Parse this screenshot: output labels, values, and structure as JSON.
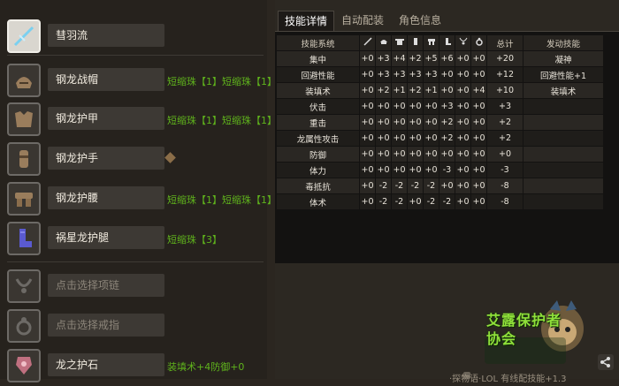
{
  "equipment": {
    "slots": [
      {
        "name": "彗羽流",
        "decorations": "",
        "icon": "sword-icon",
        "empty": false
      },
      {
        "name": "钢龙战帽",
        "decorations": "短缩珠【1】短缩珠【1】",
        "icon": "helmet-icon",
        "empty": false
      },
      {
        "name": "钢龙护甲",
        "decorations": "短缩珠【1】短缩珠【1】",
        "icon": "chest-armor-icon",
        "empty": false
      },
      {
        "name": "钢龙护手",
        "decorations": "",
        "icon": "gauntlet-icon",
        "empty": false
      },
      {
        "name": "钢龙护腰",
        "decorations": "短缩珠【1】短缩珠【1】",
        "icon": "waist-armor-icon",
        "empty": false
      },
      {
        "name": "祸星龙护腿",
        "decorations": "短缩珠【3】",
        "icon": "leg-armor-icon",
        "empty": false
      },
      {
        "name": "点击选择项链",
        "decorations": "",
        "icon": "necklace-icon",
        "empty": true
      },
      {
        "name": "点击选择戒指",
        "decorations": "",
        "icon": "ring-icon",
        "empty": true
      },
      {
        "name": "龙之护石",
        "decorations": "装填术+4防御+0",
        "icon": "talisman-icon",
        "empty": false
      }
    ]
  },
  "tabs": [
    {
      "label": "技能详情",
      "active": true
    },
    {
      "label": "自动配装",
      "active": false
    },
    {
      "label": "角色信息",
      "active": false
    }
  ],
  "skill_table": {
    "headers": {
      "system": "技能系统",
      "part_icons": [
        "weapon-icon",
        "helmet-icon",
        "chest-icon",
        "arm-icon",
        "waist-icon",
        "leg-icon",
        "amulet-icon",
        "ring-icon"
      ],
      "total": "总计",
      "activated": "发动技能"
    },
    "rows": [
      {
        "name": "集中",
        "values": [
          "+0",
          "+3",
          "+4",
          "+2",
          "+5",
          "+6",
          "+0",
          "+0"
        ],
        "total": "+20",
        "active": "凝神"
      },
      {
        "name": "回避性能",
        "values": [
          "+0",
          "+3",
          "+3",
          "+3",
          "+3",
          "+0",
          "+0",
          "+0"
        ],
        "total": "+12",
        "active": "回避性能+1"
      },
      {
        "name": "装填术",
        "values": [
          "+0",
          "+2",
          "+1",
          "+2",
          "+1",
          "+0",
          "+0",
          "+4"
        ],
        "total": "+10",
        "active": "装填术"
      },
      {
        "name": "伏击",
        "values": [
          "+0",
          "+0",
          "+0",
          "+0",
          "+0",
          "+3",
          "+0",
          "+0"
        ],
        "total": "+3",
        "active": ""
      },
      {
        "name": "重击",
        "values": [
          "+0",
          "+0",
          "+0",
          "+0",
          "+0",
          "+2",
          "+0",
          "+0"
        ],
        "total": "+2",
        "active": ""
      },
      {
        "name": "龙属性攻击",
        "values": [
          "+0",
          "+0",
          "+0",
          "+0",
          "+0",
          "+2",
          "+0",
          "+0"
        ],
        "total": "+2",
        "active": ""
      },
      {
        "name": "防御",
        "values": [
          "+0",
          "+0",
          "+0",
          "+0",
          "+0",
          "+0",
          "+0",
          "+0"
        ],
        "total": "+0",
        "active": ""
      },
      {
        "name": "体力",
        "values": [
          "+0",
          "+0",
          "+0",
          "+0",
          "+0",
          "-3",
          "+0",
          "+0"
        ],
        "total": "-3",
        "active": ""
      },
      {
        "name": "毒抵抗",
        "values": [
          "+0",
          "-2",
          "-2",
          "-2",
          "-2",
          "+0",
          "+0",
          "+0"
        ],
        "total": "-8",
        "active": ""
      },
      {
        "name": "体术",
        "values": [
          "+0",
          "-2",
          "-2",
          "+0",
          "-2",
          "-2",
          "+0",
          "+0"
        ],
        "total": "-8",
        "active": ""
      }
    ]
  },
  "footer": {
    "text": "·探物语·LOL 有线配技能+1.3"
  },
  "logo": {
    "text": "艾露保护者协会",
    "icon": "airu-cat-logo"
  },
  "share_icon": "share-icon",
  "colors": {
    "decoration_text": "#5fb31c",
    "panel_bg": "#131211",
    "row_alt": "#2a2723"
  }
}
